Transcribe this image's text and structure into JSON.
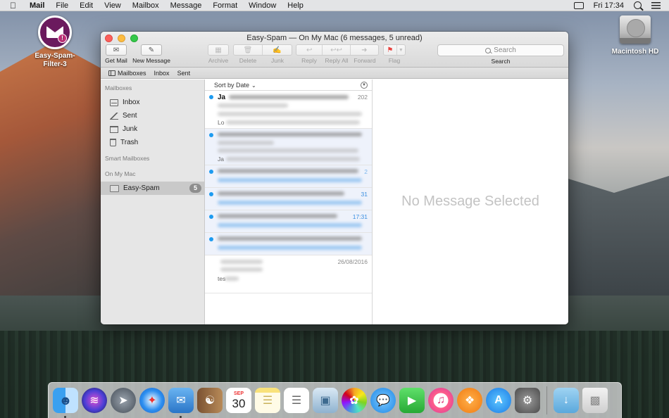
{
  "menubar": {
    "app": "Mail",
    "items": [
      "File",
      "Edit",
      "View",
      "Mailbox",
      "Message",
      "Format",
      "Window",
      "Help"
    ],
    "clock": "Fri 17:34"
  },
  "desktop": {
    "app_icon_label": "Easy-Spam-Filter-3",
    "app_icon_line1": "Easy-Spam-",
    "app_icon_line2": "Filter-3",
    "drive_label": "Macintosh HD"
  },
  "window": {
    "title": "Easy-Spam — On My Mac (6 messages, 5 unread)",
    "toolbar": {
      "get_mail": "Get Mail",
      "new_message": "New Message",
      "archive": "Archive",
      "delete": "Delete",
      "junk": "Junk",
      "reply": "Reply",
      "reply_all": "Reply All",
      "forward": "Forward",
      "flag": "Flag",
      "search_placeholder": "Search",
      "search_label": "Search"
    },
    "favorites": {
      "mailboxes": "Mailboxes",
      "inbox": "Inbox",
      "sent": "Sent"
    },
    "sidebar": {
      "mailboxes_header": "Mailboxes",
      "items": [
        {
          "label": "Inbox",
          "icon": "inbox-icon"
        },
        {
          "label": "Sent",
          "icon": "sent-icon"
        },
        {
          "label": "Junk",
          "icon": "junk-icon"
        },
        {
          "label": "Trash",
          "icon": "trash-icon"
        }
      ],
      "smart_header": "Smart Mailboxes",
      "onmymac_header": "On My Mac",
      "local": {
        "label": "Easy-Spam",
        "badge": "5"
      }
    },
    "message_list": {
      "sort_label": "Sort by Date",
      "messages": [
        {
          "sender": "Ja",
          "date": "202",
          "preview": "Lo",
          "unread": true
        },
        {
          "sender": "",
          "date": "",
          "preview": "Ja",
          "unread": true
        },
        {
          "sender": "",
          "date": "2",
          "preview": "",
          "unread": true
        },
        {
          "sender": "",
          "date": "31",
          "preview": "",
          "unread": true
        },
        {
          "sender": "",
          "date": "17:31",
          "preview": "",
          "unread": true
        },
        {
          "sender": "",
          "date": "",
          "preview": "",
          "unread": true
        },
        {
          "sender": "",
          "date": "26/08/2016",
          "preview": "tes",
          "unread": false
        }
      ]
    },
    "viewer": {
      "empty_text": "No Message Selected"
    }
  },
  "dock": {
    "apps": [
      "Finder",
      "Siri",
      "Launchpad",
      "Safari",
      "Mail",
      "Contacts",
      "Calendar",
      "Notes",
      "Reminders",
      "Preview",
      "Photos",
      "Messages",
      "FaceTime",
      "iTunes",
      "iBooks",
      "App Store",
      "System Preferences",
      "Downloads",
      "Trash"
    ],
    "calendar_month": "SEP",
    "calendar_day": "30"
  },
  "colors": {
    "unread_dot": "#1d9bf0",
    "traffic_red": "#fc605c",
    "traffic_yellow": "#fdbc40",
    "traffic_green": "#34c84a",
    "flag_red": "#e8413d"
  }
}
